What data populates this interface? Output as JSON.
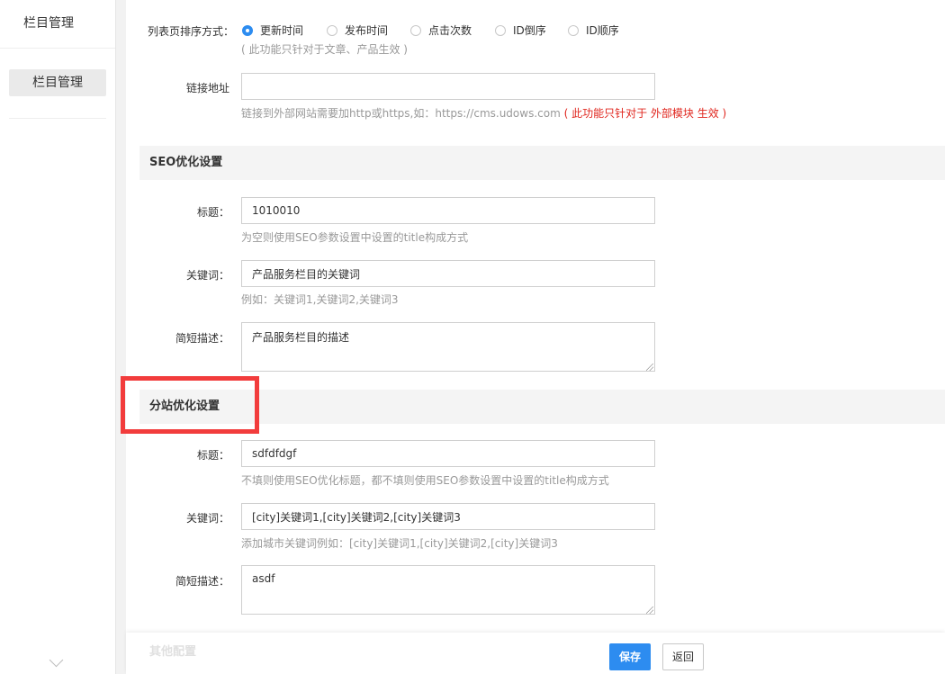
{
  "sidebar": {
    "title": "栏目管理",
    "items": [
      {
        "label": "栏目管理"
      }
    ]
  },
  "sort": {
    "label": "列表页排序方式：",
    "options": [
      "更新时间",
      "发布时间",
      "点击次数",
      "ID倒序",
      "ID顺序"
    ],
    "selected": "更新时间",
    "hint": "( 此功能只针对于文章、产品生效 )"
  },
  "link": {
    "label": "链接地址",
    "value": "",
    "hint": "链接到外部网站需要加http或https,如：https://cms.udows.com",
    "hint_red": "( 此功能只针对于 外部模块 生效 )"
  },
  "seo": {
    "section_title": "SEO优化设置",
    "title_label": "标题：",
    "title_value": "1010010",
    "title_hint": "为空则使用SEO参数设置中设置的title构成方式",
    "keywords_label": "关键词：",
    "keywords_value": "产品服务栏目的关键词",
    "keywords_hint": "例如：关键词1,关键词2,关键词3",
    "desc_label": "简短描述：",
    "desc_value": "产品服务栏目的描述"
  },
  "substation": {
    "section_title": "分站优化设置",
    "title_label": "标题：",
    "title_value": "sdfdfdgf",
    "title_hint": "不填则使用SEO优化标题，都不填则使用SEO参数设置中设置的title构成方式",
    "keywords_label": "关键词：",
    "keywords_value": "[city]关键词1,[city]关键词2,[city]关键词3",
    "keywords_hint": "添加城市关键词例如：[city]关键词1,[city]关键词2,[city]关键词3",
    "desc_label": "简短描述：",
    "desc_value": "asdf"
  },
  "footer": {
    "faded_section": "其他配置",
    "save_label": "保存",
    "back_label": "返回"
  },
  "colors": {
    "accent": "#2d8cf0",
    "highlight": "#f23c3c",
    "hint_red": "#e0261e"
  }
}
